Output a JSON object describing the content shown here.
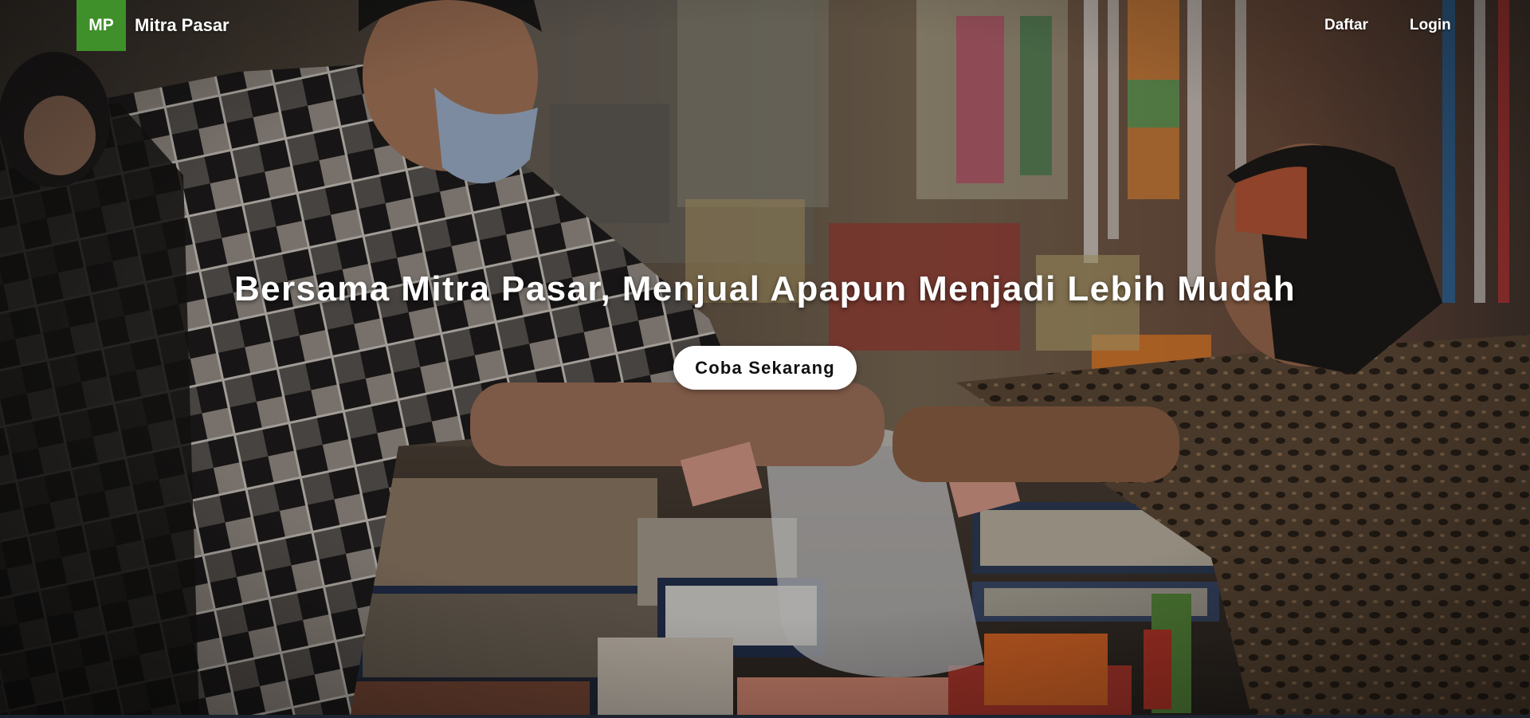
{
  "brand": {
    "logo_text": "MP",
    "name": "Mitra Pasar",
    "logo_color": "#3f8f2a"
  },
  "nav": {
    "register_label": "Daftar",
    "login_label": "Login"
  },
  "hero": {
    "headline": "Bersama Mitra Pasar, Menjual Apapun Menjadi Lebih Mudah",
    "cta_label": "Coba Sekarang",
    "background_image": "traditional-market-photo"
  }
}
